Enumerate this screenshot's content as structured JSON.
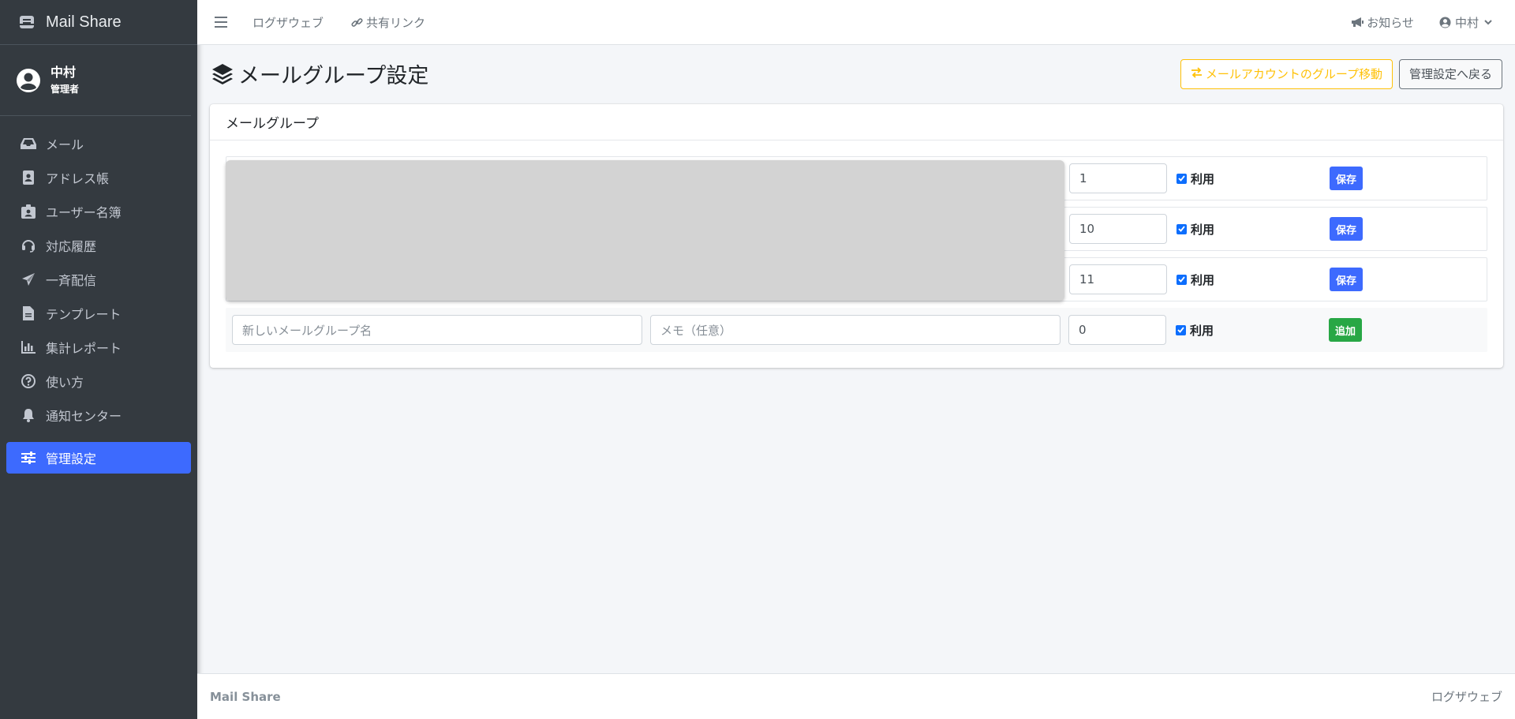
{
  "app": {
    "title": "Mail Share"
  },
  "user": {
    "name": "中村",
    "role": "管理者"
  },
  "sidebar": {
    "items": [
      {
        "label": "メール",
        "icon": "inbox-icon"
      },
      {
        "label": "アドレス帳",
        "icon": "address-book-icon"
      },
      {
        "label": "ユーザー名簿",
        "icon": "id-badge-icon"
      },
      {
        "label": "対応履歴",
        "icon": "headset-icon"
      },
      {
        "label": "一斉配信",
        "icon": "paper-plane-icon"
      },
      {
        "label": "テンプレート",
        "icon": "file-icon"
      },
      {
        "label": "集計レポート",
        "icon": "chart-bar-icon"
      },
      {
        "label": "使い方",
        "icon": "question-circle-icon"
      },
      {
        "label": "通知センター",
        "icon": "bell-icon"
      },
      {
        "label": "管理設定",
        "icon": "sliders-icon",
        "active": true
      }
    ]
  },
  "topbar": {
    "logout": "ログザウェブ",
    "share_link": "共有リンク",
    "notifications": "お知らせ",
    "user_menu": "中村"
  },
  "page": {
    "title": "メールグループ設定",
    "move_button": "メールアカウントのグループ移動",
    "back_button": "管理設定へ戻る"
  },
  "card": {
    "title": "メールグループ",
    "rows": [
      {
        "order": "1",
        "use_label": "利用",
        "save_label": "保存"
      },
      {
        "order": "10",
        "use_label": "利用",
        "save_label": "保存"
      },
      {
        "order": "11",
        "use_label": "利用",
        "save_label": "保存"
      }
    ],
    "new_row": {
      "name_placeholder": "新しいメールグループ名",
      "memo_placeholder": "メモ（任意）",
      "order": "0",
      "use_label": "利用",
      "add_label": "追加"
    }
  },
  "footer": {
    "brand": "Mail Share",
    "link": "ログザウェブ"
  },
  "colors": {
    "sidebar_bg": "#343a40",
    "active": "#3d6afe",
    "warning": "#ffc107",
    "success": "#28a745"
  }
}
